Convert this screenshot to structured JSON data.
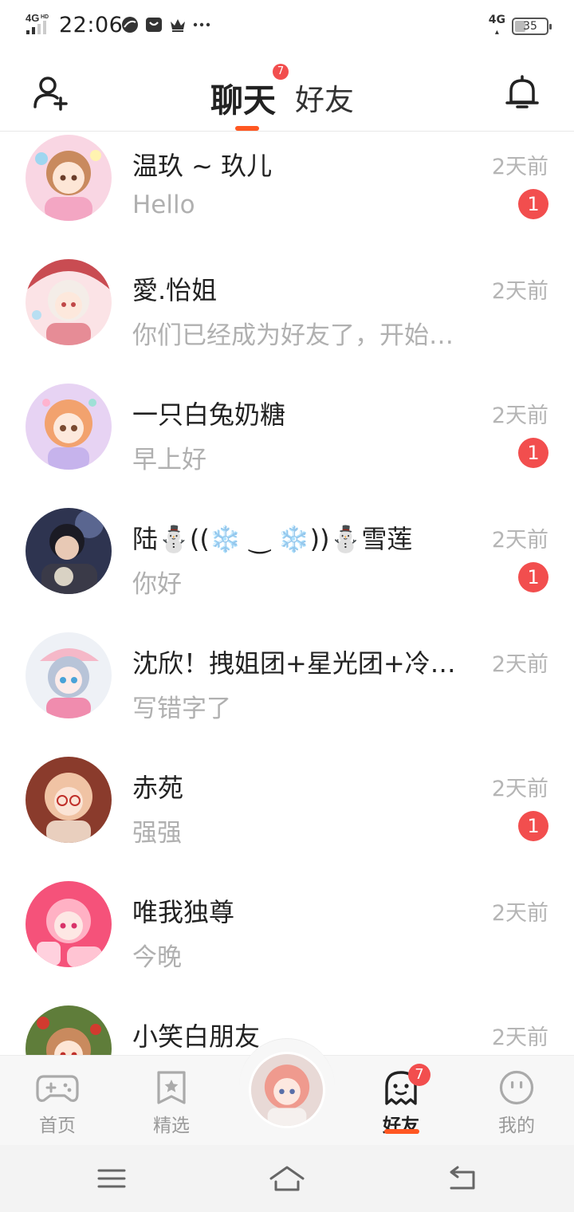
{
  "status_bar": {
    "network_type": "4G",
    "network_sub": "HD",
    "time": "22:06",
    "right_network": "4G",
    "battery": "35",
    "icons": [
      "browser-icon",
      "message-icon",
      "crown-icon",
      "more-icon"
    ]
  },
  "header": {
    "tab_chat": "聊天",
    "tab_chat_badge": "7",
    "tab_friends": "好友"
  },
  "chats": [
    {
      "name": "温玖 ~ 玖儿",
      "message": "Hello",
      "time": "2天前",
      "unread": "1"
    },
    {
      "name": "愛.怡姐",
      "message": "你们已经成为好友了，开始聊天吧",
      "time": "2天前",
      "unread": null
    },
    {
      "name": "一只白兔奶糖",
      "message": "早上好",
      "time": "2天前",
      "unread": "1"
    },
    {
      "name": "陆⛄((❄️ ‿ ❄️))⛄雪莲",
      "message": "你好",
      "time": "2天前",
      "unread": "1"
    },
    {
      "name": "沈欣！拽姐团+星光团+冷酷团",
      "message": "写错字了",
      "time": "2天前",
      "unread": null
    },
    {
      "name": "赤苑",
      "message": "强强",
      "time": "2天前",
      "unread": "1"
    },
    {
      "name": "唯我独尊",
      "message": "今晚",
      "time": "2天前",
      "unread": null
    },
    {
      "name": "小笑白朋友",
      "message": "",
      "time": "2天前",
      "unread": null
    }
  ],
  "tab_bar": {
    "home": "首页",
    "featured": "精选",
    "friends": "好友",
    "friends_badge": "7",
    "mine": "我的"
  },
  "colors": {
    "accent": "#ff5722",
    "badge": "#f24e4e",
    "muted_text": "#b0b0b0"
  }
}
